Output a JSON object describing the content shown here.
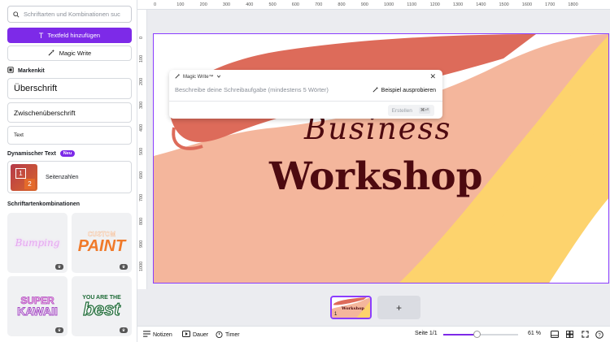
{
  "sidebar": {
    "search_placeholder": "Schriftarten und Kombinationen suc",
    "add_textbox": "Textfeld hinzufügen",
    "magic_write": "Magic Write",
    "brand_kit": "Markenkit",
    "heading": "Überschrift",
    "subheading": "Zwischenüberschrift",
    "body_text": "Text",
    "dynamic_text": "Dynamischer Text",
    "new_badge": "Neu",
    "page_numbers": "Seitenzahlen",
    "pn_icon_one": "1",
    "pn_icon_two": "2",
    "font_combinations": "Schriftartenkombinationen",
    "combos": [
      {
        "text": "Bumping"
      },
      {
        "text_top": "CUSTOM",
        "text_bottom": "PAINT"
      },
      {
        "text_top": "SUPER",
        "text_bottom": "KAWAII"
      },
      {
        "text_top": "YOU ARE THE",
        "text_bottom": "best"
      }
    ]
  },
  "ruler": {
    "top": [
      "0",
      "100",
      "200",
      "300",
      "400",
      "500",
      "600",
      "700",
      "800",
      "900",
      "1000",
      "1100",
      "1200",
      "1300",
      "1400",
      "1500",
      "1600",
      "1700",
      "1800"
    ],
    "left": [
      "0",
      "100",
      "200",
      "300",
      "400",
      "500",
      "600",
      "700",
      "800",
      "900",
      "1000"
    ]
  },
  "canvas": {
    "script_title": "Business",
    "main_title": "Workshop",
    "colors": {
      "coral": "#dd6b5a",
      "peach": "#f4b69c",
      "yellow": "#fdd36d",
      "maroon": "#4d0a10"
    }
  },
  "magic_write_panel": {
    "title": "Magic Write™",
    "input_placeholder": "Beschreibe deine Schreibaufgabe (mindestens 5 Wörter)",
    "try_example": "Beispiel ausprobieren",
    "create": "Erstellen",
    "shortcut": "⌘⏎"
  },
  "pages": {
    "thumb_number": "1",
    "thumb_title": "Workshop",
    "add_symbol": "+"
  },
  "bottombar": {
    "notes": "Notizen",
    "duration": "Dauer",
    "timer": "Timer",
    "page_indicator": "Seite 1/1",
    "zoom": "61 %",
    "zoom_level": 0.61
  }
}
